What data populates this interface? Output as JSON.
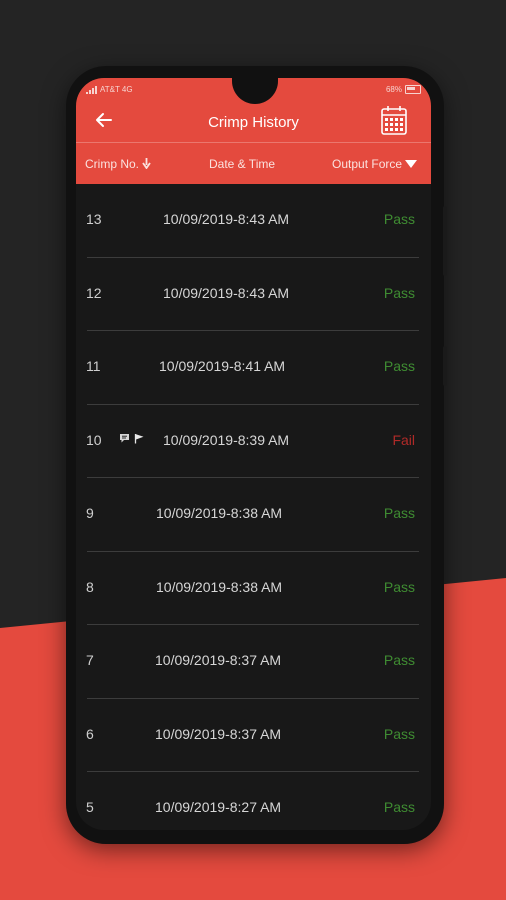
{
  "status": {
    "carrier": "AT&T 4G",
    "battery": "68%"
  },
  "header": {
    "title": "Crimp History"
  },
  "columns": {
    "crimp_no": "Crimp No.",
    "date_time": "Date & Time",
    "output_force": "Output Force"
  },
  "colors": {
    "accent": "#e44a3e",
    "pass": "#3f8c32",
    "fail": "#b02a28"
  },
  "rows": [
    {
      "num": "13",
      "date": "10/09/2019-8:43 AM",
      "result": "Pass"
    },
    {
      "num": "12",
      "date": "10/09/2019-8:43 AM",
      "result": "Pass"
    },
    {
      "num": "11",
      "date": "10/09/2019-8:41 AM",
      "result": "Pass"
    },
    {
      "num": "10",
      "date": "10/09/2019-8:39 AM",
      "result": "Fail"
    },
    {
      "num": "9",
      "date": "10/09/2019-8:38 AM",
      "result": "Pass"
    },
    {
      "num": "8",
      "date": "10/09/2019-8:38 AM",
      "result": "Pass"
    },
    {
      "num": "7",
      "date": "10/09/2019-8:37 AM",
      "result": "Pass"
    },
    {
      "num": "6",
      "date": "10/09/2019-8:37 AM",
      "result": "Pass"
    },
    {
      "num": "5",
      "date": "10/09/2019-8:27 AM",
      "result": "Pass"
    }
  ]
}
